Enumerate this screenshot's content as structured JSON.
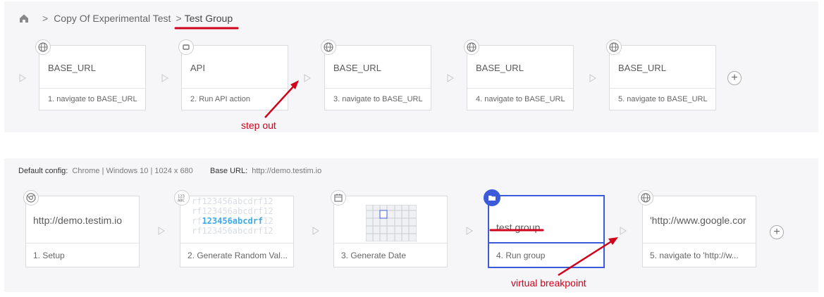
{
  "breadcrumb": {
    "items": [
      "Copy Of Experimental Test",
      "Test Group"
    ],
    "separator": ">"
  },
  "top_steps": [
    {
      "title": "BASE_URL",
      "footer": "1. navigate to BASE_URL",
      "icon": "globe-icon"
    },
    {
      "title": "API",
      "footer": "2. Run API action",
      "icon": "api-icon"
    },
    {
      "title": "BASE_URL",
      "footer": "3. navigate to BASE_URL",
      "icon": "globe-icon"
    },
    {
      "title": "BASE_URL",
      "footer": "4. navigate to BASE_URL",
      "icon": "globe-icon"
    },
    {
      "title": "BASE_URL",
      "footer": "5. navigate to BASE_URL",
      "icon": "globe-icon"
    }
  ],
  "config": {
    "default_label": "Default config:",
    "default_value": "Chrome | Windows 10 | 1024 x 680",
    "base_url_label": "Base URL:",
    "base_url_value": "http://demo.testim.io"
  },
  "bottom_steps": [
    {
      "title": "http://demo.testim.io",
      "footer": "1. Setup",
      "icon": "chrome-icon"
    },
    {
      "title": "",
      "footer": "2. Generate Random Val...",
      "icon": "random-values-icon",
      "random_text": [
        "rf123456abcdrf12",
        "rf123456abcdrf12",
        "rf123456abcdrf12",
        "rf123456abcdrf12"
      ],
      "highlight": "123456abcdrf"
    },
    {
      "title": "",
      "footer": "3. Generate Date",
      "icon": "calendar-icon"
    },
    {
      "title": "test group",
      "footer": "4. Run group",
      "icon": "folder-icon"
    },
    {
      "title": "'http://www.google.cor",
      "footer": "5. navigate to 'http://w...",
      "icon": "globe-icon"
    }
  ],
  "annotations": {
    "step_out": "step out",
    "virtual_breakpoint": "virtual breakpoint"
  },
  "add_label": "+",
  "colors": {
    "annotation": "#d0021b",
    "selected": "#3b5bdb",
    "panel": "#f6f6f8"
  }
}
